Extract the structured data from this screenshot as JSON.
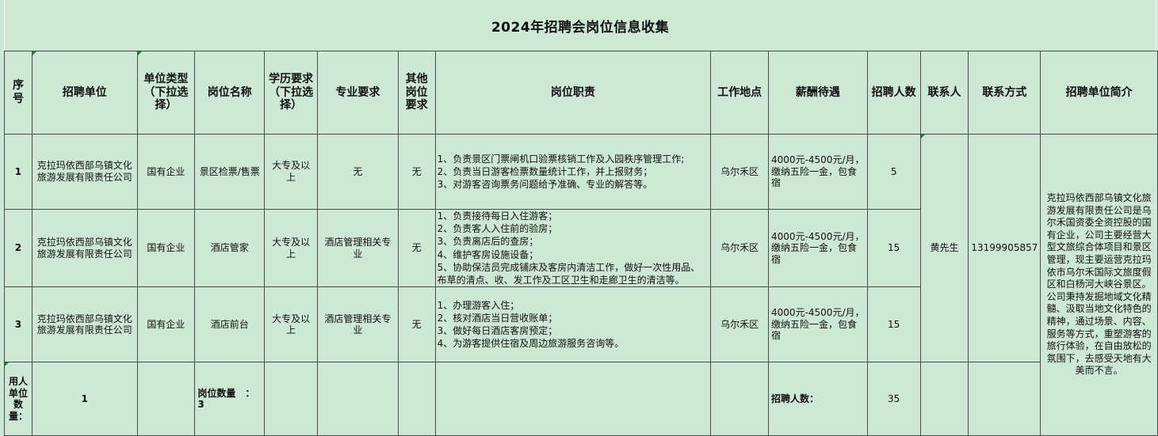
{
  "title": "2024年招聘会岗位信息收集",
  "headers": {
    "seq": "序号",
    "company": "招聘单位",
    "unit_type": "单位类型（下拉选择）",
    "position": "岗位名称",
    "education": "学历要求（下拉选择）",
    "major": "专业要求",
    "other": "其他岗位要求",
    "duties": "岗位职责",
    "location": "工作地点",
    "salary": "薪酬待遇",
    "count": "招聘人数",
    "contact": "联系人",
    "phone": "联系方式",
    "intro": "招聘单位简介"
  },
  "rows": [
    {
      "seq": "1",
      "company": "克拉玛依西部乌镇文化旅游发展有限责任公司",
      "unit_type": "国有企业",
      "position": "景区检票/售票",
      "education": "大专及以上",
      "major": "无",
      "other": "无",
      "duties": [
        "1、负责景区门票闸机口验票核销工作及入园秩序管理工作;",
        "2、负责当日游客检票数量统计工作，并上报财务；",
        "3、对游客咨询票务问题给予准确、专业的解答等。"
      ],
      "location": "乌尔禾区",
      "salary": "4000元-4500元/月，缴纳五险一金，包食宿",
      "count": "5"
    },
    {
      "seq": "2",
      "company": "克拉玛依西部乌镇文化旅游发展有限责任公司",
      "unit_type": "国有企业",
      "position": "酒店管家",
      "education": "大专及以上",
      "major": "酒店管理相关专业",
      "other": "无",
      "duties": [
        "1、负责接待每日入住游客；",
        "2、负责客人入住前的验房；",
        "3、负责离店后的查房；",
        "4、维护客房设施设备；",
        "5、协助保洁员完成铺床及客房内清洁工作，做好一次性用品、布草的清点、收、发工作及工区卫生和走廊卫生的清洁等。"
      ],
      "location": "乌尔禾区",
      "salary": "4000元-4500元/月，缴纳五险一金，包食宿",
      "count": "15"
    },
    {
      "seq": "3",
      "company": "克拉玛依西部乌镇文化旅游发展有限责任公司",
      "unit_type": "国有企业",
      "position": "酒店前台",
      "education": "大专及以上",
      "major": "酒店管理相关专业",
      "other": "无",
      "duties": [
        "1、办理游客入住；",
        "2、核对酒店当日营收账单；",
        "3、做好每日酒店客房预定；",
        "4、为游客提供住宿及周边旅游服务咨询等。"
      ],
      "location": "乌尔禾区",
      "salary": "4000元-4500元/月，缴纳五险一金，包食宿",
      "count": "15"
    }
  ],
  "contact": "黄先生",
  "phone": "13199905857",
  "intro": "克拉玛依西部乌镇文化旅游发展有限责任公司是乌尔禾国资委全资控股的国有企业，公司主要经营大型文旅综合体项目和景区管理，现主要运营克拉玛依市乌尔禾国际文旅度假区和白杨河大峡谷景区。公司秉持发掘地域文化精髓、汲取当地文化特色的精神，通过场景、内容、服务等方式，重塑游客的旅行体验，在自由放松的氛围下，去感受天地有大美而不言。",
  "footer": {
    "unit_count_label": "用人单位数量：",
    "unit_count": "1",
    "position_count_label": "岗位数量　：",
    "position_count": "3",
    "hire_total_label": "招聘人数：",
    "hire_total": "35"
  }
}
